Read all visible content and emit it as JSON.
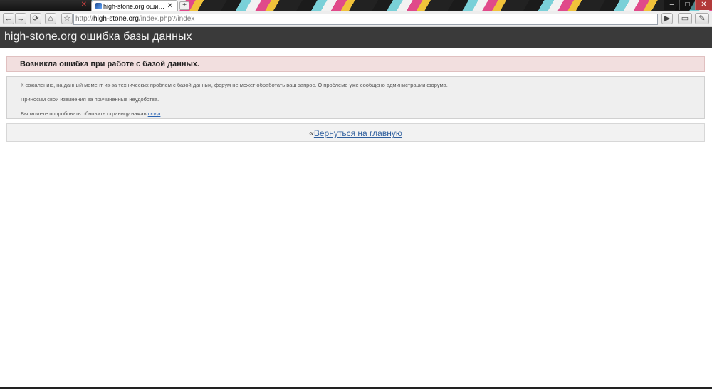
{
  "browser": {
    "tabs": [
      {
        "label": "high-stone.org ошибка ..."
      }
    ],
    "address": {
      "prefix": "http://",
      "domain": "high-stone.org",
      "path": "/index.php?/index"
    },
    "window_controls": [
      "–",
      "□",
      "✕"
    ]
  },
  "page": {
    "header_title": "high-stone.org ошибка базы данных",
    "error_title": "Возникла ошибка при работе с базой данных.",
    "messages": {
      "line1": "К сожалению, на данный момент из-за технических проблем с базой данных, форум не может обработать ваш запрос. О проблеме уже сообщено администрации форума.",
      "line2": "Приносим свои извинения за причиненные неудобства.",
      "line3_prefix": "Вы можете попробовать обновить страницу нажав ",
      "line3_link": "сюда"
    },
    "back": {
      "prefix": "«",
      "link": "Вернуться на главную"
    }
  },
  "colors": {
    "header_bg": "#3a3a3a",
    "error_bg": "#f2dfdf",
    "message_bg": "#efefef",
    "link": "#2f5f9e"
  },
  "icons": [
    "back-arrow-icon",
    "forward-arrow-icon",
    "reload-icon",
    "home-icon",
    "star-icon",
    "play-icon",
    "page-icon",
    "wrench-icon"
  ]
}
